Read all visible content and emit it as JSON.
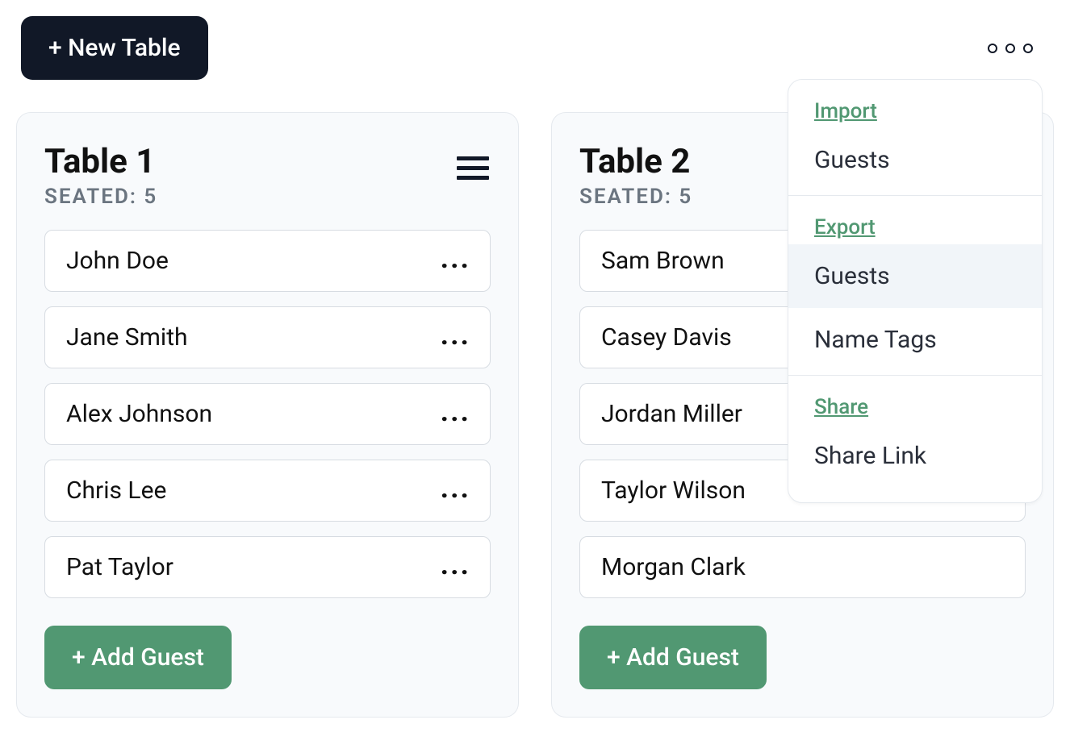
{
  "topbar": {
    "new_table_label": "+ New Table"
  },
  "tables": [
    {
      "title": "Table 1",
      "seated_label": "SEATED: 5",
      "guests": [
        "John Doe",
        "Jane Smith",
        "Alex Johnson",
        "Chris Lee",
        "Pat Taylor"
      ],
      "add_guest_label": "+ Add Guest"
    },
    {
      "title": "Table 2",
      "seated_label": "SEATED: 5",
      "guests": [
        "Sam Brown",
        "Casey Davis",
        "Jordan Miller",
        "Taylor Wilson",
        "Morgan Clark"
      ],
      "add_guest_label": "+ Add Guest"
    }
  ],
  "dropdown": {
    "sections": [
      {
        "heading": "Import",
        "items": [
          "Guests"
        ]
      },
      {
        "heading": "Export",
        "items": [
          "Guests",
          "Name Tags"
        ]
      },
      {
        "heading": "Share",
        "items": [
          "Share Link"
        ]
      }
    ],
    "hovered": "Export:Guests"
  }
}
